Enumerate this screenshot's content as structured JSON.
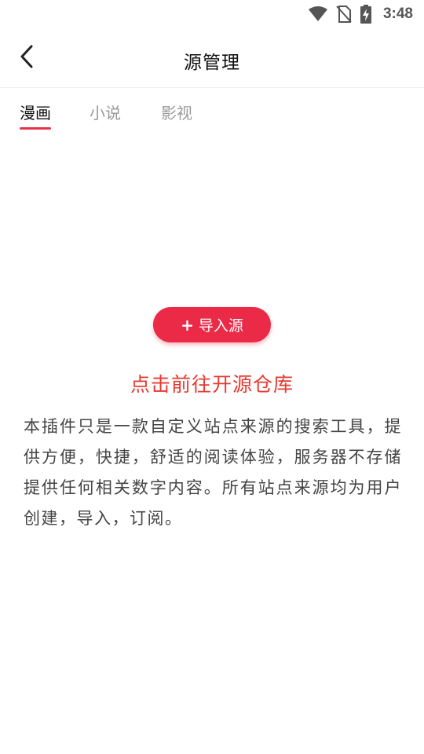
{
  "status_bar": {
    "time": "3:48",
    "icons": [
      "wifi-icon",
      "no-sim-icon",
      "battery-charging-icon"
    ]
  },
  "header": {
    "title": "源管理",
    "back_icon": "chevron-left-icon"
  },
  "tabs": [
    {
      "label": "漫画",
      "active": true
    },
    {
      "label": "小说",
      "active": false
    },
    {
      "label": "影视",
      "active": false
    }
  ],
  "main": {
    "import_button": {
      "plus": "+",
      "label": "导入源"
    },
    "repo_link": "点击前往开源仓库",
    "description": "本插件只是一款自定义站点来源的搜索工具，提供方便，快捷，舒适的阅读体验，服务器不存储提供任何相关数字内容。所有站点来源均为用户创建，导入，订阅。"
  },
  "colors": {
    "accent": "#ea2a47",
    "link": "#e8392f",
    "tab_indicator": "#e8304a"
  }
}
